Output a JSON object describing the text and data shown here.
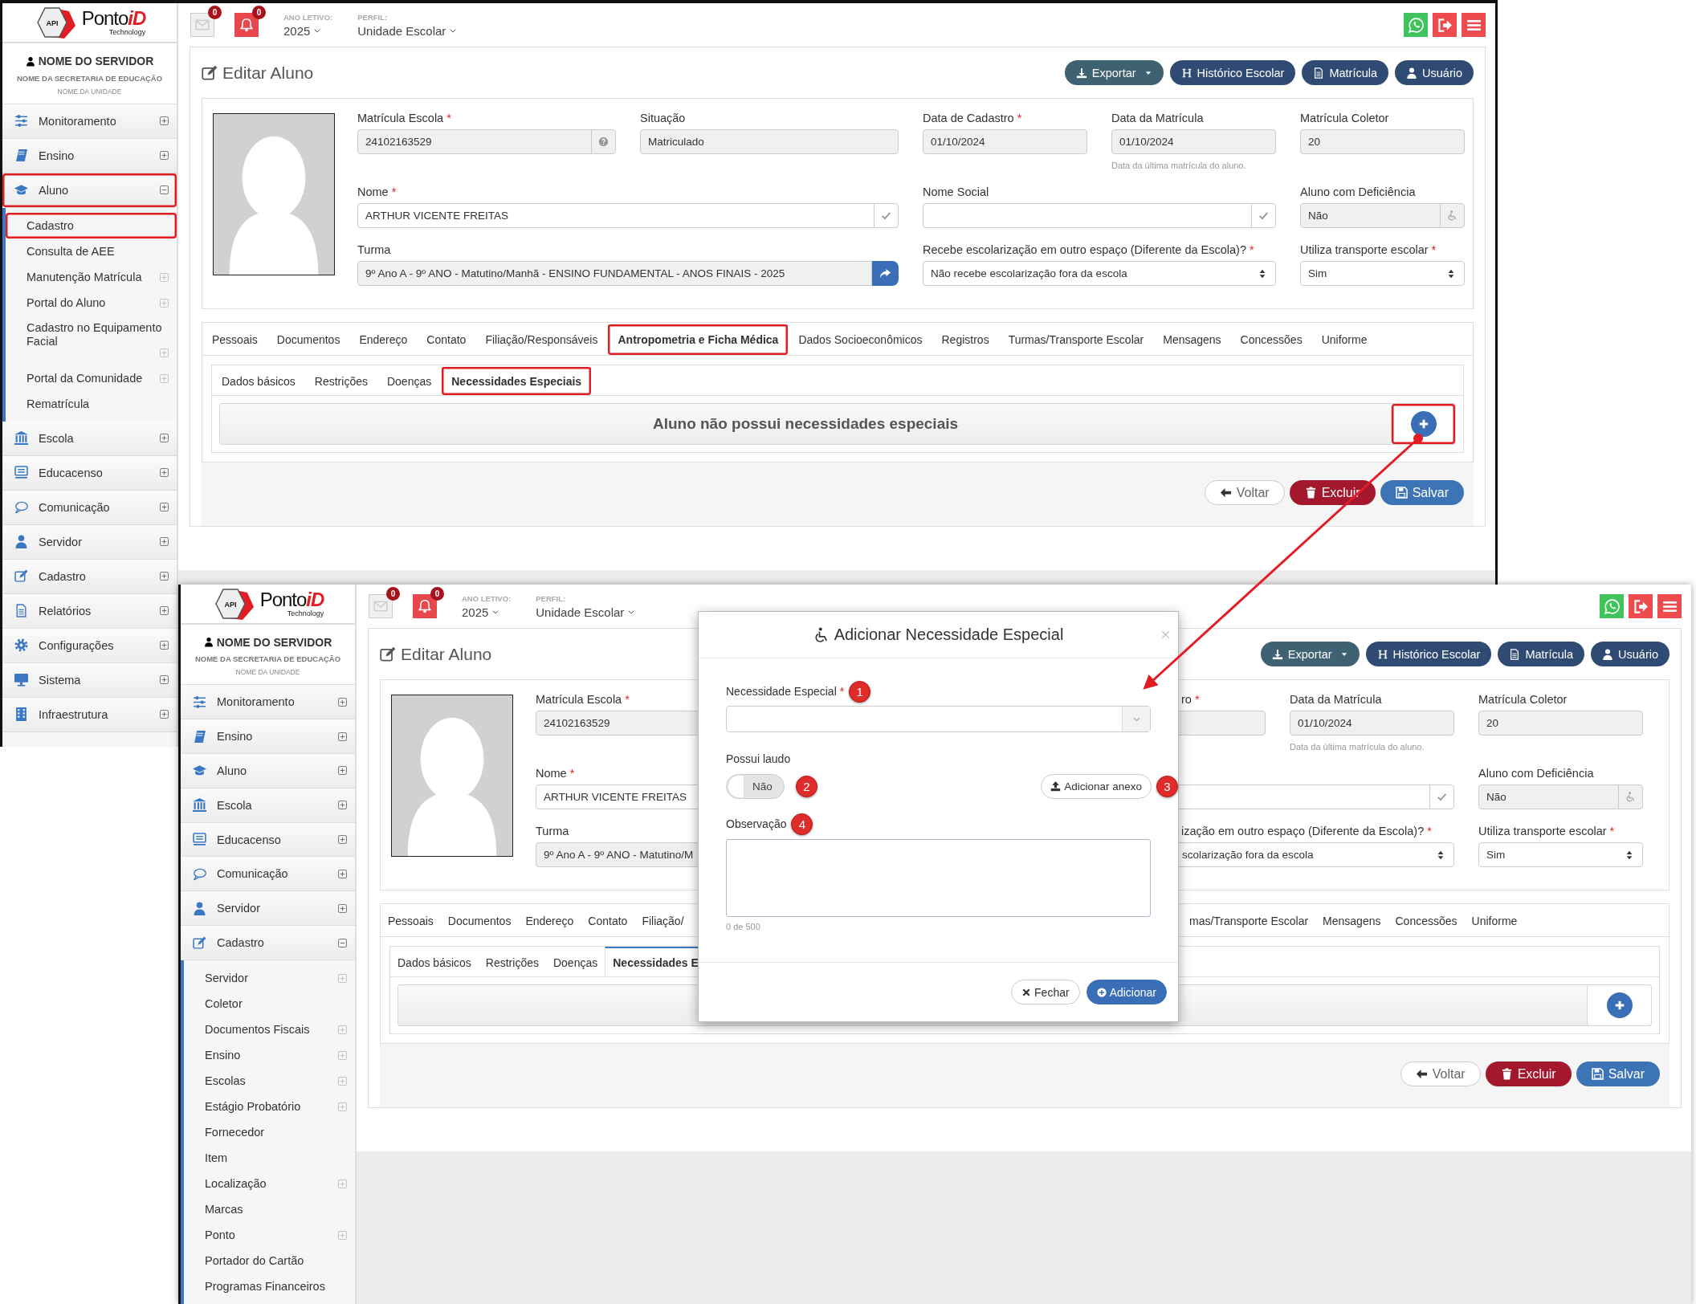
{
  "screenshots": [
    {
      "logo": {
        "badge": "API",
        "name": "Ponto",
        "accent": "iD",
        "tagline": "Technology"
      },
      "topbar": {
        "mail_count": "0",
        "alert_count": "0",
        "year_label": "ANO LETIVO:",
        "year": "2025",
        "profile_label": "PERFIL:",
        "profile": "Unidade Escolar"
      },
      "user": {
        "name": "NOME DO SERVIDOR",
        "department": "NOME DA SECRETARIA DE EDUCAÇÃO",
        "unit": "NOME DA UNIDADE"
      },
      "sidebar": [
        {
          "label": "Monitoramento",
          "expanded": false,
          "highlighted": false
        },
        {
          "label": "Ensino",
          "expanded": false,
          "highlighted": false
        },
        {
          "label": "Aluno",
          "expanded": true,
          "highlighted": true,
          "children": [
            {
              "label": "Cadastro",
              "kind": "link",
              "highlighted": true
            },
            {
              "label": "Consulta de AEE",
              "kind": "link",
              "highlighted": false
            },
            {
              "label": "Manutenção Matrícula",
              "kind": "group",
              "highlighted": false
            },
            {
              "label": "Portal do Aluno",
              "kind": "group",
              "highlighted": false
            },
            {
              "label": "Cadastro no Equipamento Facial",
              "kind": "group",
              "highlighted": false
            },
            {
              "label": "Portal da Comunidade",
              "kind": "group",
              "highlighted": false
            },
            {
              "label": "Rematrícula",
              "kind": "link",
              "highlighted": false
            }
          ]
        },
        {
          "label": "Escola",
          "expanded": false,
          "highlighted": false
        },
        {
          "label": "Educacenso",
          "expanded": false,
          "highlighted": false
        },
        {
          "label": "Comunicação",
          "expanded": false,
          "highlighted": false
        },
        {
          "label": "Servidor",
          "expanded": false,
          "highlighted": false
        },
        {
          "label": "Cadastro",
          "expanded": false,
          "highlighted": false
        },
        {
          "label": "Relatórios",
          "expanded": false,
          "highlighted": false
        },
        {
          "label": "Configurações",
          "expanded": false,
          "highlighted": false
        },
        {
          "label": "Sistema",
          "expanded": false,
          "highlighted": false
        },
        {
          "label": "Infraestrutura",
          "expanded": false,
          "highlighted": false
        }
      ],
      "page_title": "Editar Aluno",
      "actions": [
        {
          "label": "Exportar",
          "kind": "export"
        },
        {
          "label": "Histórico Escolar",
          "kind": "history"
        },
        {
          "label": "Matrícula",
          "kind": "enrollment"
        },
        {
          "label": "Usuário",
          "kind": "user"
        }
      ],
      "fields": {
        "matricula_escola": {
          "label": "Matrícula Escola",
          "mark": "*",
          "value": "24102163529"
        },
        "situacao": {
          "label": "Situação",
          "value": "Matriculado"
        },
        "data_de_cadastro": {
          "label": "Data de Cadastro",
          "mark": "*",
          "value": "01/10/2024"
        },
        "data_da_matricula": {
          "label": "Data da Matrícula",
          "value": "01/10/2024",
          "hint": "Data da última matrícula do aluno."
        },
        "matricula_coletor": {
          "label": "Matrícula Coletor",
          "value": "20"
        },
        "nome": {
          "label": "Nome",
          "mark": "*",
          "value": "ARTHUR VICENTE FREITAS"
        },
        "nome_social": {
          "label": "Nome Social"
        },
        "aluno_com_deficiencia": {
          "label": "Aluno com Deficiência",
          "value": "Não"
        },
        "turma": {
          "label": "Turma",
          "value": "9º Ano A - 9º ANO - Matutino/Manhã - ENSINO FUNDAMENTAL - ANOS FINAIS - 2025"
        },
        "escolarizacao_externa": {
          "label": "Recebe escolarização em outro espaço (Diferente da Escola)?",
          "mark": "*",
          "value": "Não recebe escolarização fora da escola"
        },
        "transporte_escolar": {
          "label": "Utiliza transporte escolar",
          "mark": "*",
          "value": "Sim"
        }
      },
      "tabs": [
        {
          "label": "Pessoais",
          "selected": false,
          "highlighted": false
        },
        {
          "label": "Documentos",
          "selected": false,
          "highlighted": false
        },
        {
          "label": "Endereço",
          "selected": false,
          "highlighted": false
        },
        {
          "label": "Contato",
          "selected": false,
          "highlighted": false
        },
        {
          "label": "Filiação/Responsáveis",
          "selected": false,
          "highlighted": false
        },
        {
          "label": "Antropometria e Ficha Médica",
          "selected": true,
          "highlighted": true
        },
        {
          "label": "Dados Socioeconômicos",
          "selected": false,
          "highlighted": false
        },
        {
          "label": "Registros",
          "selected": false,
          "highlighted": false
        },
        {
          "label": "Turmas/Transporte Escolar",
          "selected": false,
          "highlighted": false
        },
        {
          "label": "Mensagens",
          "selected": false,
          "highlighted": false
        },
        {
          "label": "Concessões",
          "selected": false,
          "highlighted": false
        },
        {
          "label": "Uniforme",
          "selected": false,
          "highlighted": false
        }
      ],
      "subtabs": [
        {
          "label": "Dados básicos",
          "selected": false,
          "highlighted": false
        },
        {
          "label": "Restrições",
          "selected": false,
          "highlighted": false
        },
        {
          "label": "Doenças",
          "selected": false,
          "highlighted": false
        },
        {
          "label": "Necessidades Especiais",
          "selected": true,
          "highlighted": true
        }
      ],
      "message": "Aluno não possui necessidades especiais",
      "add_button": {
        "highlighted": true
      },
      "footer_buttons": [
        {
          "label": "Voltar",
          "kind": "back"
        },
        {
          "label": "Excluir",
          "kind": "delete"
        },
        {
          "label": "Salvar",
          "kind": "save"
        }
      ]
    },
    {
      "logo": {
        "badge": "API",
        "name": "Ponto",
        "accent": "iD",
        "tagline": "Technology"
      },
      "topbar": {
        "mail_count": "0",
        "alert_count": "0",
        "year_label": "ANO LETIVO:",
        "year": "2025",
        "profile_label": "PERFIL:",
        "profile": "Unidade Escolar"
      },
      "user": {
        "name": "NOME DO SERVIDOR",
        "department": "NOME DA SECRETARIA DE EDUCAÇÃO",
        "unit": "NOME DA UNIDADE"
      },
      "sidebar": [
        {
          "label": "Monitoramento",
          "expanded": false,
          "highlighted": false
        },
        {
          "label": "Ensino",
          "expanded": false,
          "highlighted": false
        },
        {
          "label": "Aluno",
          "expanded": false,
          "highlighted": false
        },
        {
          "label": "Escola",
          "expanded": false,
          "highlighted": false
        },
        {
          "label": "Educacenso",
          "expanded": false,
          "highlighted": false
        },
        {
          "label": "Comunicação",
          "expanded": false,
          "highlighted": false
        },
        {
          "label": "Servidor",
          "expanded": false,
          "highlighted": false
        },
        {
          "label": "Cadastro",
          "expanded": true,
          "highlighted": false,
          "children": [
            {
              "label": "Servidor",
              "kind": "group",
              "highlighted": false
            },
            {
              "label": "Coletor",
              "kind": "link",
              "highlighted": false
            },
            {
              "label": "Documentos Fiscais",
              "kind": "group",
              "highlighted": false
            },
            {
              "label": "Ensino",
              "kind": "group",
              "highlighted": false
            },
            {
              "label": "Escolas",
              "kind": "group",
              "highlighted": false
            },
            {
              "label": "Estágio Probatório",
              "kind": "group",
              "highlighted": false
            },
            {
              "label": "Fornecedor",
              "kind": "link",
              "highlighted": false
            },
            {
              "label": "Item",
              "kind": "link",
              "highlighted": false
            },
            {
              "label": "Localização",
              "kind": "group",
              "highlighted": false
            },
            {
              "label": "Marcas",
              "kind": "link",
              "highlighted": false
            },
            {
              "label": "Ponto",
              "kind": "group",
              "highlighted": false
            },
            {
              "label": "Portador do Cartão",
              "kind": "link",
              "highlighted": false
            },
            {
              "label": "Programas Financeiros",
              "kind": "link",
              "highlighted": false
            }
          ]
        }
      ],
      "page_title": "Editar Aluno",
      "actions": [
        {
          "label": "Exportar",
          "kind": "export"
        },
        {
          "label": "Histórico Escolar",
          "kind": "history"
        },
        {
          "label": "Matrícula",
          "kind": "enrollment"
        },
        {
          "label": "Usuário",
          "kind": "user"
        }
      ],
      "fields": {
        "matricula_escola": {
          "label": "Matrícula Escola",
          "mark": "*",
          "value": "24102163529"
        },
        "data_de_cadastro": {
          "label": "ro",
          "mark": "*"
        },
        "data_da_matricula": {
          "label": "Data da Matrícula",
          "value": "01/10/2024",
          "hint": "Data da última matrícula do aluno."
        },
        "matricula_coletor": {
          "label": "Matrícula Coletor",
          "value": "20"
        },
        "nome": {
          "label": "Nome",
          "mark": "*",
          "value": "ARTHUR VICENTE FREITAS"
        },
        "aluno_com_deficiencia": {
          "label": "Aluno com Deficiência",
          "value": "Não"
        },
        "turma": {
          "label": "Turma",
          "value": "9º Ano A - 9º ANO - Matutino/M"
        },
        "escolarizacao_externa": {
          "label": "ização em outro espaço (Diferente da Escola)?",
          "mark": "*",
          "value": "scolarização fora da escola"
        },
        "transporte_escolar": {
          "label": "Utiliza transporte escolar",
          "mark": "*",
          "value": "Sim"
        }
      },
      "tabs": [
        {
          "label": "Pessoais",
          "selected": false,
          "highlighted": false
        },
        {
          "label": "Documentos",
          "selected": false,
          "highlighted": false
        },
        {
          "label": "Endereço",
          "selected": false,
          "highlighted": false
        },
        {
          "label": "Contato",
          "selected": false,
          "highlighted": false
        },
        {
          "label": "Filiação/",
          "selected": false,
          "highlighted": false
        }
      ],
      "tabs_after_dialog": [
        {
          "label": "mas/Transporte Escolar",
          "selected": false,
          "highlighted": false
        },
        {
          "label": "Mensagens",
          "selected": false,
          "highlighted": false
        },
        {
          "label": "Concessões",
          "selected": false,
          "highlighted": false
        },
        {
          "label": "Uniforme",
          "selected": false,
          "highlighted": false
        }
      ],
      "subtabs": [
        {
          "label": "Dados básicos",
          "selected": false,
          "highlighted": false
        },
        {
          "label": "Restrições",
          "selected": false,
          "highlighted": false
        },
        {
          "label": "Doenças",
          "selected": false,
          "highlighted": false
        },
        {
          "label": "Necessidades E",
          "selected": true,
          "highlighted": false
        }
      ],
      "add_button": {
        "highlighted": false
      },
      "footer_buttons": [
        {
          "label": "Voltar",
          "kind": "back"
        },
        {
          "label": "Excluir",
          "kind": "delete"
        },
        {
          "label": "Salvar",
          "kind": "save"
        }
      ],
      "dialog": {
        "title": "Adicionar Necessidade Especial",
        "fields": [
          {
            "kind": "select",
            "label": "Necessidade Especial",
            "mark": "*",
            "step": "1"
          },
          {
            "kind": "toggle",
            "label": "Possui laudo",
            "on": false,
            "value": "Não",
            "step": "2"
          },
          {
            "kind": "textarea",
            "label": "Observação",
            "step": "4",
            "counter": "0 de 500"
          }
        ],
        "attach_button": {
          "label": "Adicionar anexo",
          "step": "3"
        },
        "buttons": [
          {
            "label": "Fechar",
            "kind": "close"
          },
          {
            "label": "Adicionar",
            "kind": "add"
          }
        ]
      }
    }
  ]
}
